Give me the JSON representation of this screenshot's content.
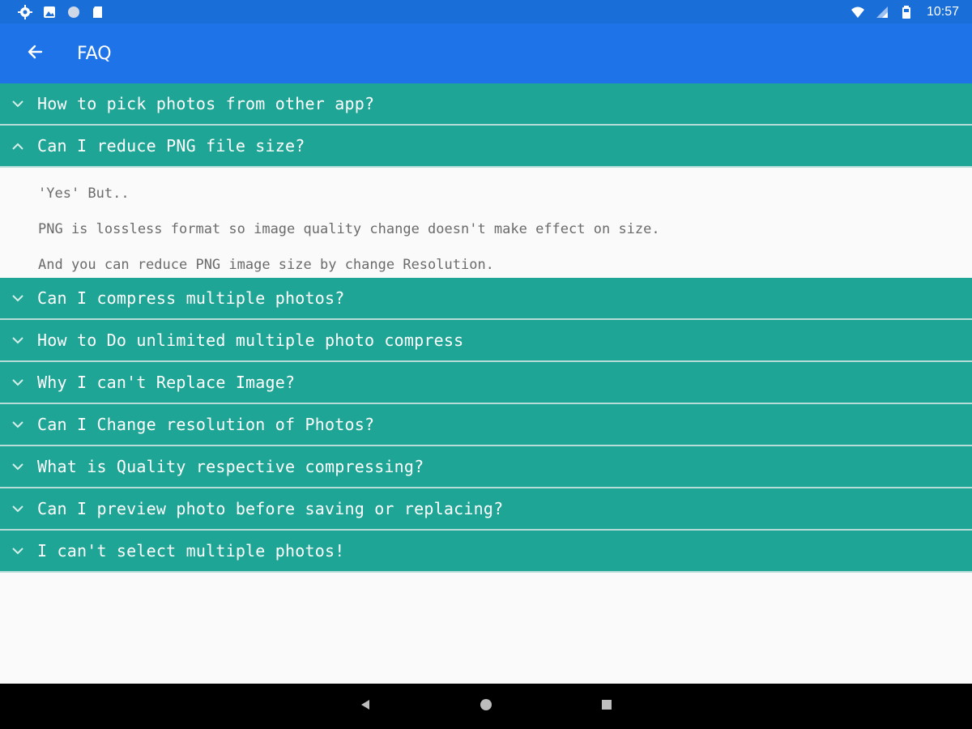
{
  "status_bar": {
    "time": "10:57",
    "left_icons": [
      "settings-icon",
      "photo-icon",
      "circle-icon",
      "sd-card-icon"
    ],
    "right_icons": [
      "wifi-icon",
      "signal-icon",
      "battery-icon"
    ]
  },
  "app_bar": {
    "title": "FAQ",
    "back_icon": "arrow-back-icon"
  },
  "faq": {
    "items": [
      {
        "question": "How to pick photos from other app?",
        "expanded": false
      },
      {
        "question": "Can I reduce PNG file size?",
        "expanded": true,
        "answer": [
          "'Yes' But..",
          "PNG is lossless format so image quality change doesn't make effect on size.",
          "And you can reduce PNG image size by change Resolution."
        ]
      },
      {
        "question": "Can I compress multiple photos?",
        "expanded": false
      },
      {
        "question": "How to Do unlimited multiple photo compress",
        "expanded": false
      },
      {
        "question": "Why I can't Replace Image?",
        "expanded": false
      },
      {
        "question": "Can I Change resolution of Photos?",
        "expanded": false
      },
      {
        "question": "What is Quality respective compressing?",
        "expanded": false
      },
      {
        "question": "Can I preview photo before saving or replacing?",
        "expanded": false
      },
      {
        "question": "I can't select multiple photos!",
        "expanded": false
      }
    ]
  },
  "colors": {
    "status_bar": "#1a6ed8",
    "app_bar": "#1e73e8",
    "faq_header": "#1fa595",
    "nav_bar": "#000000"
  },
  "nav_bar": {
    "buttons": [
      "back-triangle-icon",
      "home-circle-icon",
      "recents-square-icon"
    ]
  }
}
